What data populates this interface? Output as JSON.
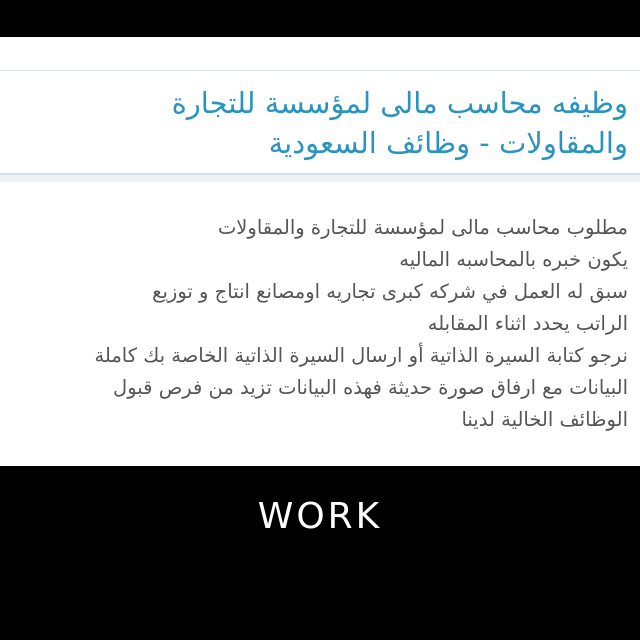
{
  "post": {
    "title": "وظيفه محاسب مالى لمؤسسة للتجارة\nوالمقاولات - وظائف السعودية",
    "body_lines": [
      "مطلوب محاسب مالى لمؤسسة للتجارة والمقاولات",
      "يكون خبره بالمحاسبه الماليه",
      "سبق له العمل في شركه كبرى تجاريه اومصانع انتاج و توزيع",
      "الراتب يحدد اثناء المقابله",
      "نرجو كتابة السيرة الذاتية أو ارسال السيرة الذاتية الخاصة بك كاملة",
      "البيانات مع ارفاق صورة حديثة فهذه البيانات تزيد من فرص قبول",
      "الوظائف الخالية لدينا"
    ]
  },
  "footer": {
    "label": "WORK"
  },
  "colors": {
    "title": "#2a93bf",
    "body": "#555555",
    "background_dark": "#000000"
  }
}
